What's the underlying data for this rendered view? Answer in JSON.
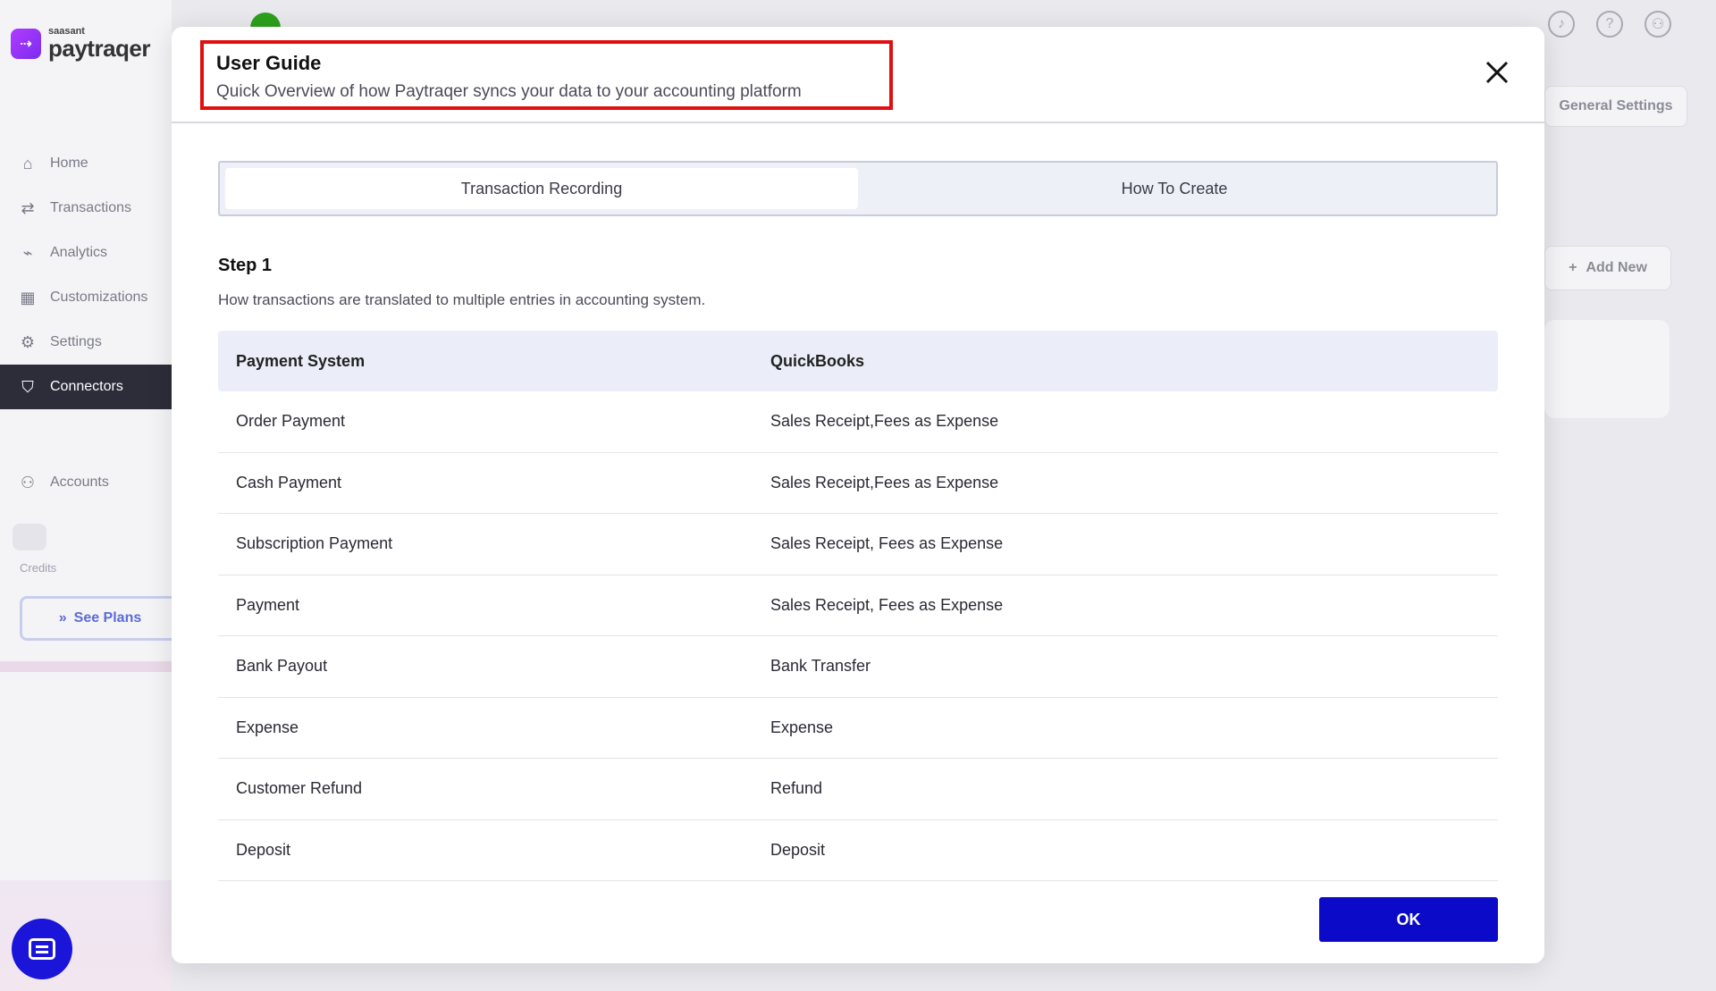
{
  "background": {
    "logo": {
      "brand": "saasant",
      "name": "paytraqer"
    },
    "nav": [
      {
        "icon": "home-icon",
        "glyph": "⌂",
        "label": "Home"
      },
      {
        "icon": "transactions-icon",
        "glyph": "⇄",
        "label": "Transactions"
      },
      {
        "icon": "analytics-icon",
        "glyph": "⌁",
        "label": "Analytics"
      },
      {
        "icon": "customizations-icon",
        "glyph": "▦",
        "label": "Customizations"
      },
      {
        "icon": "settings-icon",
        "glyph": "⚙",
        "label": "Settings"
      },
      {
        "icon": "connectors-icon",
        "glyph": "⛉",
        "label": "Connectors"
      }
    ],
    "accounts_label": "Accounts",
    "credits_label": "Credits",
    "see_plans_label": "See Plans",
    "general_settings_label": "General Settings",
    "add_new_label": "Add New"
  },
  "modal": {
    "title": "User Guide",
    "subtitle": "Quick Overview of how Paytraqer syncs your data to your accounting platform",
    "tabs": [
      {
        "label": "Transaction Recording",
        "active": true
      },
      {
        "label": "How To Create",
        "active": false
      }
    ],
    "step_title": "Step 1",
    "step_description": "How transactions are translated to multiple entries in accounting system.",
    "table": {
      "headers": [
        "Payment System",
        "QuickBooks"
      ],
      "rows": [
        [
          "Order Payment",
          "Sales Receipt,Fees as Expense"
        ],
        [
          "Cash Payment",
          "Sales Receipt,Fees as Expense"
        ],
        [
          "Subscription Payment",
          "Sales Receipt, Fees as Expense"
        ],
        [
          "Payment",
          "Sales Receipt, Fees as Expense"
        ],
        [
          "Bank Payout",
          "Bank Transfer"
        ],
        [
          "Expense",
          "Expense"
        ],
        [
          "Customer Refund",
          "Refund"
        ],
        [
          "Deposit",
          "Deposit"
        ]
      ]
    },
    "ok_label": "OK"
  },
  "colors": {
    "primary": "#0a0ac8",
    "highlight_border": "#e01010",
    "header_row_bg": "#ebeef8"
  }
}
